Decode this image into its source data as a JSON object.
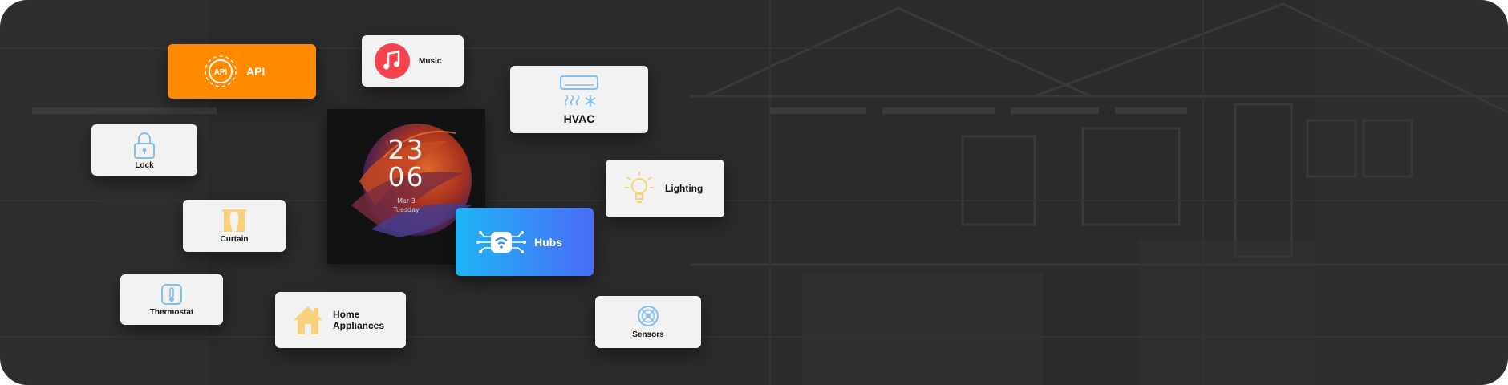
{
  "colors": {
    "background": "#2b2b2b",
    "card": "#f2f2f2",
    "api_accent": "#ff8a00",
    "hubs_gradient_start": "#1fb4f5",
    "hubs_gradient_end": "#4a6cf7",
    "icon_blue": "#7fc0ee",
    "icon_yellow": "#f8d27a",
    "music_red": "#f7424e"
  },
  "cards": {
    "api": {
      "label": "API",
      "icon_text": "API",
      "icon": "api-gear-icon"
    },
    "music": {
      "label": "Music",
      "icon": "music-note-icon"
    },
    "hvac": {
      "label": "HVAC",
      "icon": "air-conditioner-icon"
    },
    "lock": {
      "label": "Lock",
      "icon": "padlock-icon"
    },
    "lighting": {
      "label": "Lighting",
      "icon": "light-bulb-icon"
    },
    "curtain": {
      "label": "Curtain",
      "icon": "curtain-icon"
    },
    "hubs": {
      "label": "Hubs",
      "icon": "wifi-hub-icon"
    },
    "thermostat": {
      "label": "Thermostat",
      "icon": "thermometer-icon"
    },
    "home_appliances": {
      "label_line1": "Home",
      "label_line2": "Appliances",
      "icon": "house-icon"
    },
    "sensors": {
      "label": "Sensors",
      "icon": "sensor-icon"
    }
  },
  "device": {
    "hours": "23",
    "minutes": "06",
    "date": "Mar 3",
    "weekday": "Tuesday"
  }
}
